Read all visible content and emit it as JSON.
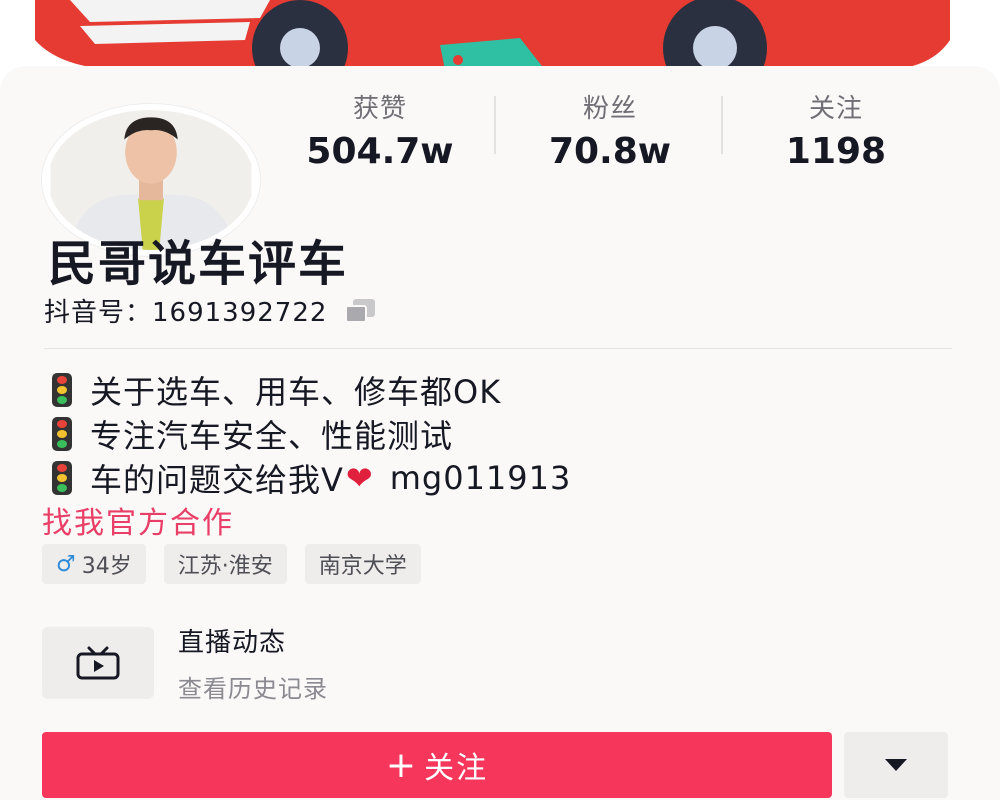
{
  "profile": {
    "nickname": "民哥说车评车",
    "uid_text": "抖音号：1691392722"
  },
  "stats": {
    "likes_label": "获赞",
    "likes_value": "504.7w",
    "fans_label": "粉丝",
    "fans_value": "70.8w",
    "following_label": "关注",
    "following_value": "1198"
  },
  "bio": {
    "line1": "关于选车、用车、修车都OK",
    "line2": "专注汽车安全、性能测试",
    "line3_prefix": "车的问题交给我V",
    "line3_heart": "❤",
    "line3_suffix": "mg011913",
    "coop_link": "找我官方合作"
  },
  "tags": {
    "gender_symbol": "♂",
    "age": "34岁",
    "location": "江苏·淮安",
    "school": "南京大学"
  },
  "live": {
    "title": "直播动态",
    "subtitle": "查看历史记录",
    "icon": "tv-icon"
  },
  "actions": {
    "follow_plus": "+",
    "follow_label": "关注",
    "more_icon": "caret-down-icon"
  },
  "colors": {
    "accent": "#f6365a",
    "link": "#e83e67",
    "male": "#2f8bd8",
    "banner_red": "#e53b32"
  }
}
